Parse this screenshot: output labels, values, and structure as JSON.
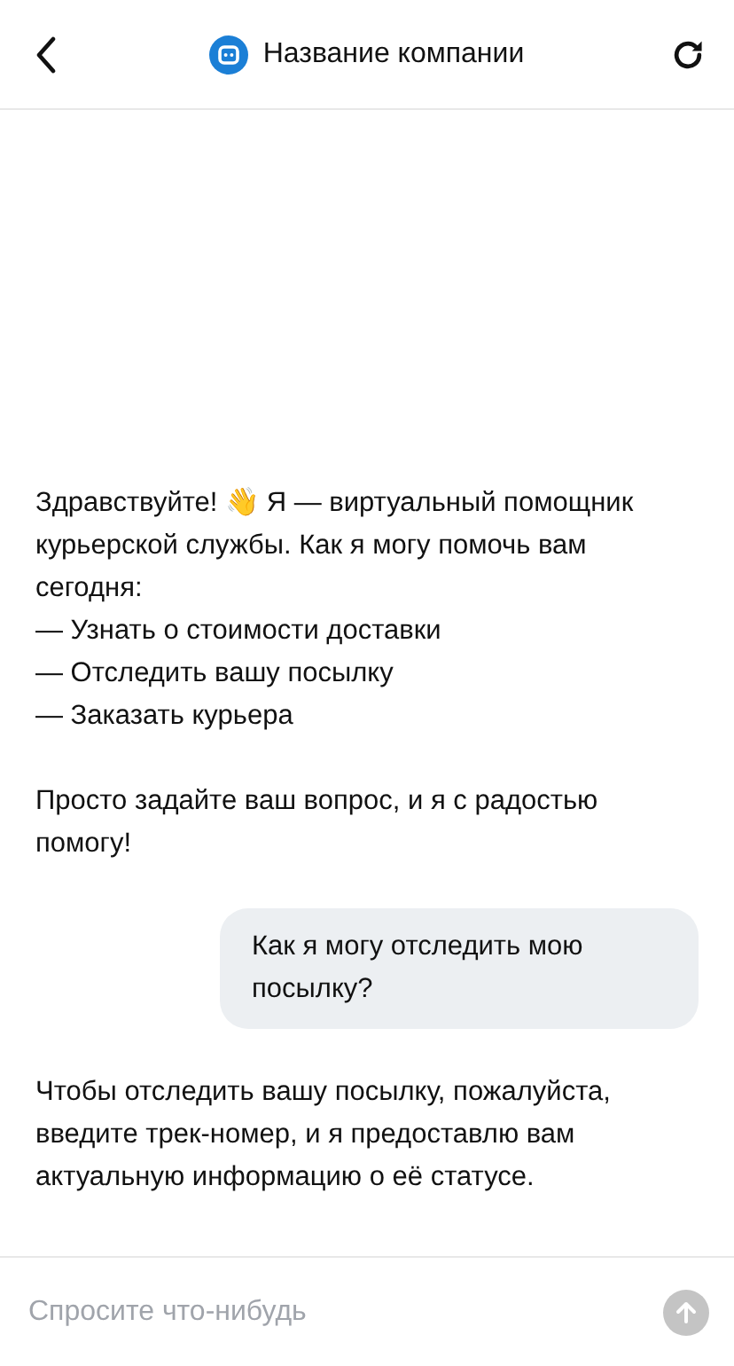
{
  "header": {
    "title": "Название компании"
  },
  "messages": [
    {
      "kind": "bot",
      "paragraphs": [
        [
          "Здравствуйте! 👋 Я — виртуальный помощник курьерской службы. Как я могу помочь вам сегодня:",
          "— Узнать о стоимости доставки",
          "— Отследить вашу посылку",
          "— Заказать курьера"
        ],
        [
          "Просто задайте ваш вопрос, и я с радостью помогу!"
        ]
      ]
    },
    {
      "kind": "user",
      "paragraphs": [
        [
          "Как я могу отследить мою посылку?"
        ]
      ]
    },
    {
      "kind": "bot",
      "paragraphs": [
        [
          "Чтобы отследить вашу посылку, пожалуйста, введите трек-номер, и я предоставлю вам актуальную информацию о её статусе."
        ]
      ]
    }
  ],
  "composer": {
    "placeholder": "Спросите что-нибудь",
    "send_disabled": true
  }
}
